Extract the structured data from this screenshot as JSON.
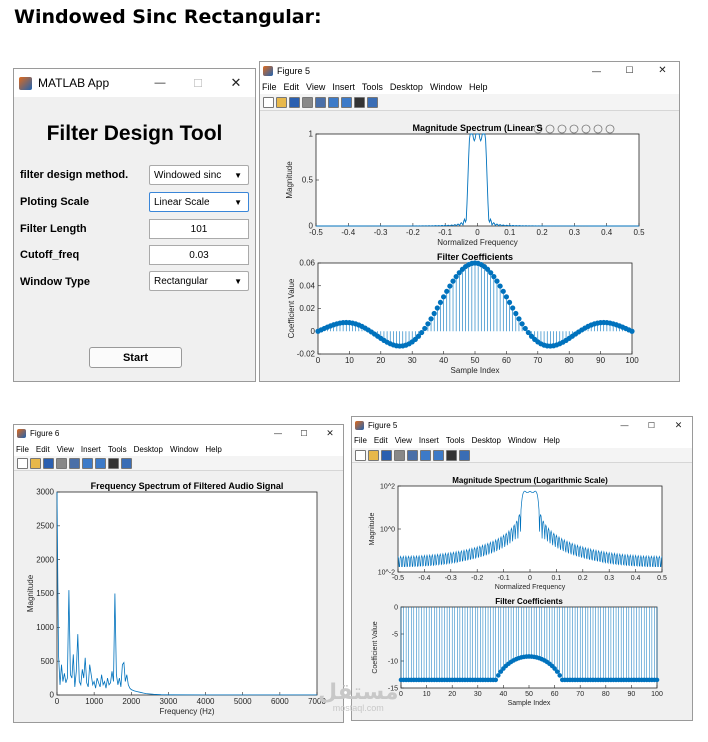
{
  "page_title": "Windowed Sinc Rectangular:",
  "app": {
    "window_title": "MATLAB App",
    "heading": "Filter Design Tool",
    "fields": [
      {
        "label": "filter design method.",
        "value": "Windowed sinc",
        "kind": "dropdown"
      },
      {
        "label": "Ploting Scale",
        "value": "Linear Scale",
        "kind": "dropdown"
      },
      {
        "label": "Filter Length",
        "value": "101",
        "kind": "edit"
      },
      {
        "label": "Cutoff_freq",
        "value": "0.03",
        "kind": "edit"
      },
      {
        "label": "Window Type",
        "value": "Rectangular",
        "kind": "dropdown"
      }
    ],
    "start_label": "Start",
    "controls": {
      "minimize": "—",
      "maximize": "☐",
      "close": "✕"
    }
  },
  "menus": [
    "File",
    "Edit",
    "View",
    "Insert",
    "Tools",
    "Desktop",
    "Window",
    "Help"
  ],
  "figures": [
    {
      "window_title": "Figure 5"
    },
    {
      "window_title": "Figure 6"
    },
    {
      "window_title": "Figure 5"
    }
  ],
  "colors": {
    "line": "#0072BD",
    "axes_bg": "#ffffff",
    "figure_bg": "#f0f0f0"
  },
  "watermark": {
    "text": "مستقل",
    "sub": "mostaql.com"
  },
  "chart_data": [
    {
      "type": "line",
      "title": "Magnitude Spectrum (Linear S",
      "xlabel": "Normalized Frequency",
      "ylabel": "Magnitude",
      "xlim": [
        -0.5,
        0.5
      ],
      "ylim": [
        0,
        1
      ],
      "xticks": [
        "-0.5",
        "-0.4",
        "-0.3",
        "-0.2",
        "-0.1",
        "0",
        "0.1",
        "0.2",
        "0.3",
        "0.4",
        "0.5"
      ],
      "yticks": [
        "0",
        "0.5",
        "1"
      ]
    },
    {
      "type": "scatter",
      "title": "Filter Coefficients",
      "xlabel": "Sample Index",
      "ylabel": "Coefficient Value",
      "xlim": [
        0,
        100
      ],
      "ylim": [
        -0.02,
        0.06
      ],
      "xticks": [
        "0",
        "10",
        "20",
        "30",
        "40",
        "50",
        "60",
        "70",
        "80",
        "90",
        "100"
      ],
      "yticks": [
        "-0.02",
        "0",
        "0.02",
        "0.04",
        "0.06"
      ],
      "cutoff": 0.03,
      "n": 101
    },
    {
      "type": "line",
      "title": "Frequency Spectrum of Filtered Audio Signal",
      "xlabel": "Frequency (Hz)",
      "ylabel": "Magnitude",
      "xlim": [
        0,
        7000
      ],
      "ylim": [
        0,
        3000
      ],
      "xticks": [
        "0",
        "1000",
        "2000",
        "3000",
        "4000",
        "5000",
        "6000",
        "7000"
      ],
      "yticks": [
        "0",
        "500",
        "1000",
        "1500",
        "2000",
        "2500",
        "3000"
      ],
      "x": [
        0,
        40,
        80,
        120,
        160,
        200,
        240,
        280,
        320,
        360,
        400,
        440,
        480,
        520,
        560,
        600,
        640,
        680,
        720,
        760,
        800,
        840,
        880,
        920,
        960,
        1000,
        1040,
        1080,
        1120,
        1160,
        1200,
        1240,
        1280,
        1320,
        1360,
        1400,
        1440,
        1480,
        1520,
        1560,
        1600,
        1640,
        1680,
        1720,
        1760,
        1800,
        1840,
        1880,
        1920,
        1960,
        2000,
        2080,
        2160,
        2240,
        2320,
        2400,
        2600,
        2800,
        3000,
        4000,
        5000,
        6000,
        7000
      ],
      "y": [
        3000,
        600,
        150,
        450,
        200,
        320,
        180,
        250,
        1550,
        300,
        250,
        600,
        120,
        350,
        900,
        200,
        150,
        380,
        250,
        550,
        180,
        120,
        450,
        300,
        150,
        200,
        100,
        250,
        180,
        120,
        300,
        150,
        200,
        100,
        250,
        150,
        180,
        350,
        200,
        1500,
        300,
        150,
        250,
        120,
        450,
        480,
        200,
        300,
        150,
        100,
        80,
        60,
        50,
        40,
        30,
        20,
        10,
        5,
        3,
        2,
        1,
        1,
        1
      ]
    },
    {
      "type": "line",
      "title": "Magnitude Spectrum (Logarithmic Scale)",
      "xlabel": "Normalized Frequency",
      "ylabel": "Magnitude",
      "yscale": "log",
      "xlim": [
        -0.5,
        0.5
      ],
      "ylim": [
        0.01,
        200
      ],
      "xticks": [
        "-0.5",
        "-0.4",
        "-0.3",
        "-0.2",
        "-0.1",
        "0",
        "0.1",
        "0.2",
        "0.3",
        "0.4",
        "0.5"
      ],
      "yticks": [
        "10^-2",
        "10^0",
        "10^2"
      ]
    },
    {
      "type": "scatter",
      "title": "Filter Coefficients",
      "xlabel": "Sample Index",
      "ylabel": "Coefficient Value",
      "xlim": [
        0,
        100
      ],
      "xticks": [
        "0",
        "10",
        "20",
        "30",
        "40",
        "50",
        "60",
        "70",
        "80",
        "90",
        "100"
      ],
      "yticks": [
        "-15",
        "-10",
        "-5",
        "0"
      ]
    }
  ]
}
